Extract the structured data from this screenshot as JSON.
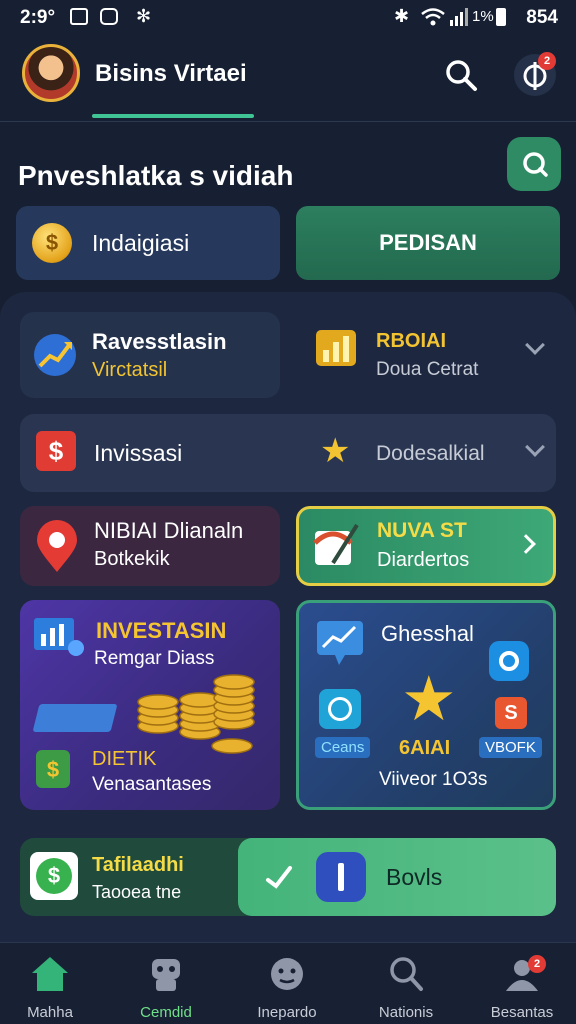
{
  "status_bar": {
    "time": "2:9°",
    "battery": "1%",
    "right_text": "854"
  },
  "header": {
    "title": "Bisins Virtaei",
    "notification_count": "2"
  },
  "section": {
    "title": "Pnveshlatka s vidiah"
  },
  "actions": {
    "left_label": "Indaigiasi",
    "right_label": "PEDISAN"
  },
  "rows": [
    {
      "left_title": "Ravesstlasin",
      "left_sub": "Virctatsil",
      "right_title": "RBOIAI",
      "right_sub": "Doua Cetrat"
    },
    {
      "left_title": "Invissasi",
      "right_title": "Dodesalkial"
    }
  ],
  "cards": {
    "alert": {
      "title": "NIBIAI Dlianaln",
      "sub": "Botkekik"
    },
    "highlight": {
      "title": "NUVA ST",
      "sub": "Diardertos"
    }
  },
  "promo_left": {
    "title": "INVESTASIN",
    "sub": "Remgar Diass",
    "title2": "DIETIK",
    "sub2": "Venasantases"
  },
  "promo_right": {
    "title": "Ghesshal",
    "left_chip": "Ceans",
    "center_label": "6AIAI",
    "right_chip": "VBOFK",
    "caption": "Viiveor 1O3s"
  },
  "bottom": {
    "title": "Tafilaadhi",
    "sub": "Taooea tne",
    "right_label": "Bovls"
  },
  "nav": [
    {
      "label": "Mahha",
      "active": true
    },
    {
      "label": "Cemdid",
      "active": false
    },
    {
      "label": "Inepardo",
      "active": false
    },
    {
      "label": "Nationis",
      "active": false
    },
    {
      "label": "Besantas",
      "active": false,
      "badge": "2"
    }
  ],
  "colors": {
    "accent": "#40c496",
    "background": "#172032",
    "highlight_border": "#e5ce45",
    "badge": "#e23b36"
  }
}
